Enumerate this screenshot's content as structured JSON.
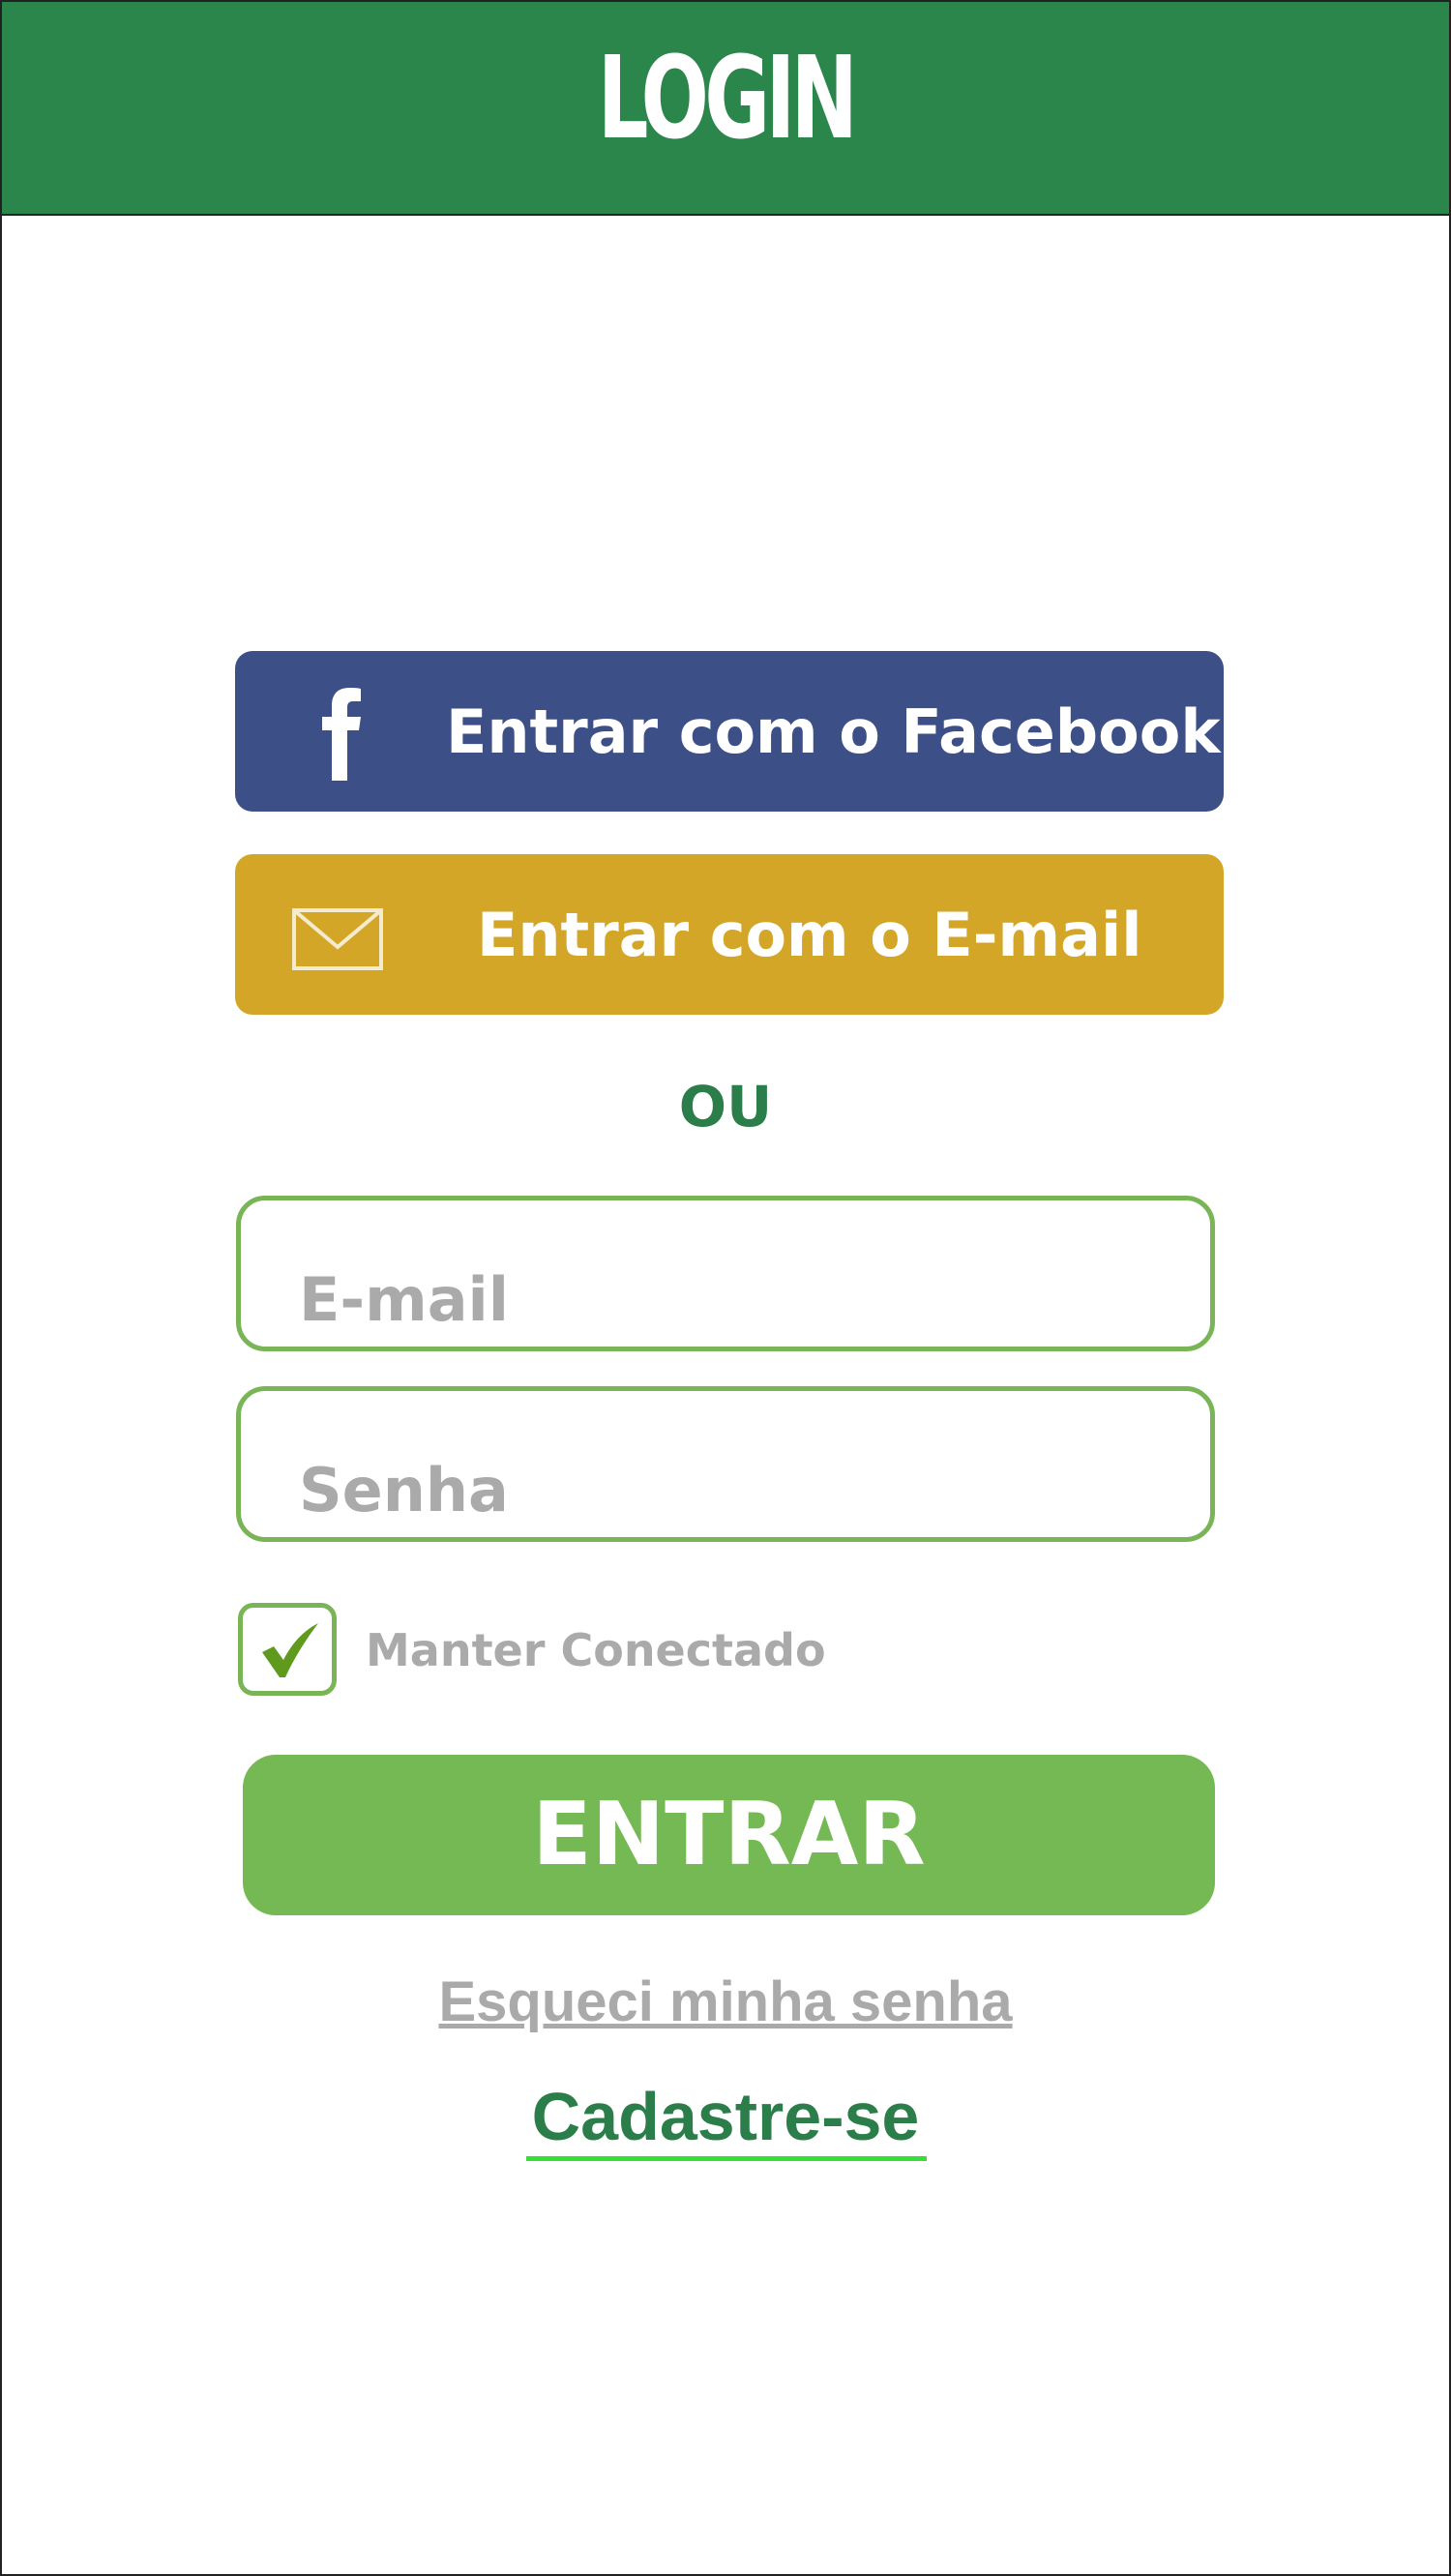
{
  "header": {
    "title": "LOGIN"
  },
  "social": {
    "facebook_label": "Entrar com o Facebook",
    "email_label": "Entrar com o E-mail"
  },
  "divider": {
    "text": "OU"
  },
  "form": {
    "email_placeholder": "E-mail",
    "password_placeholder": "Senha",
    "keep_connected_label": "Manter Conectado",
    "keep_connected_checked": true,
    "submit_label": "ENTRAR"
  },
  "links": {
    "forgot_password": "Esqueci minha senha",
    "signup": "Cadastre-se"
  },
  "icons": {
    "facebook": "facebook-icon",
    "mail": "mail-icon",
    "check": "checkmark-icon"
  },
  "colors": {
    "header_bg": "#2b864c",
    "facebook_bg": "#3c4f87",
    "email_bg": "#d3a628",
    "accent_green": "#75b955",
    "field_border": "#79b557",
    "divider_text": "#2b7d49",
    "placeholder_text": "#aaaaaa",
    "signup_underline": "#33e033"
  }
}
